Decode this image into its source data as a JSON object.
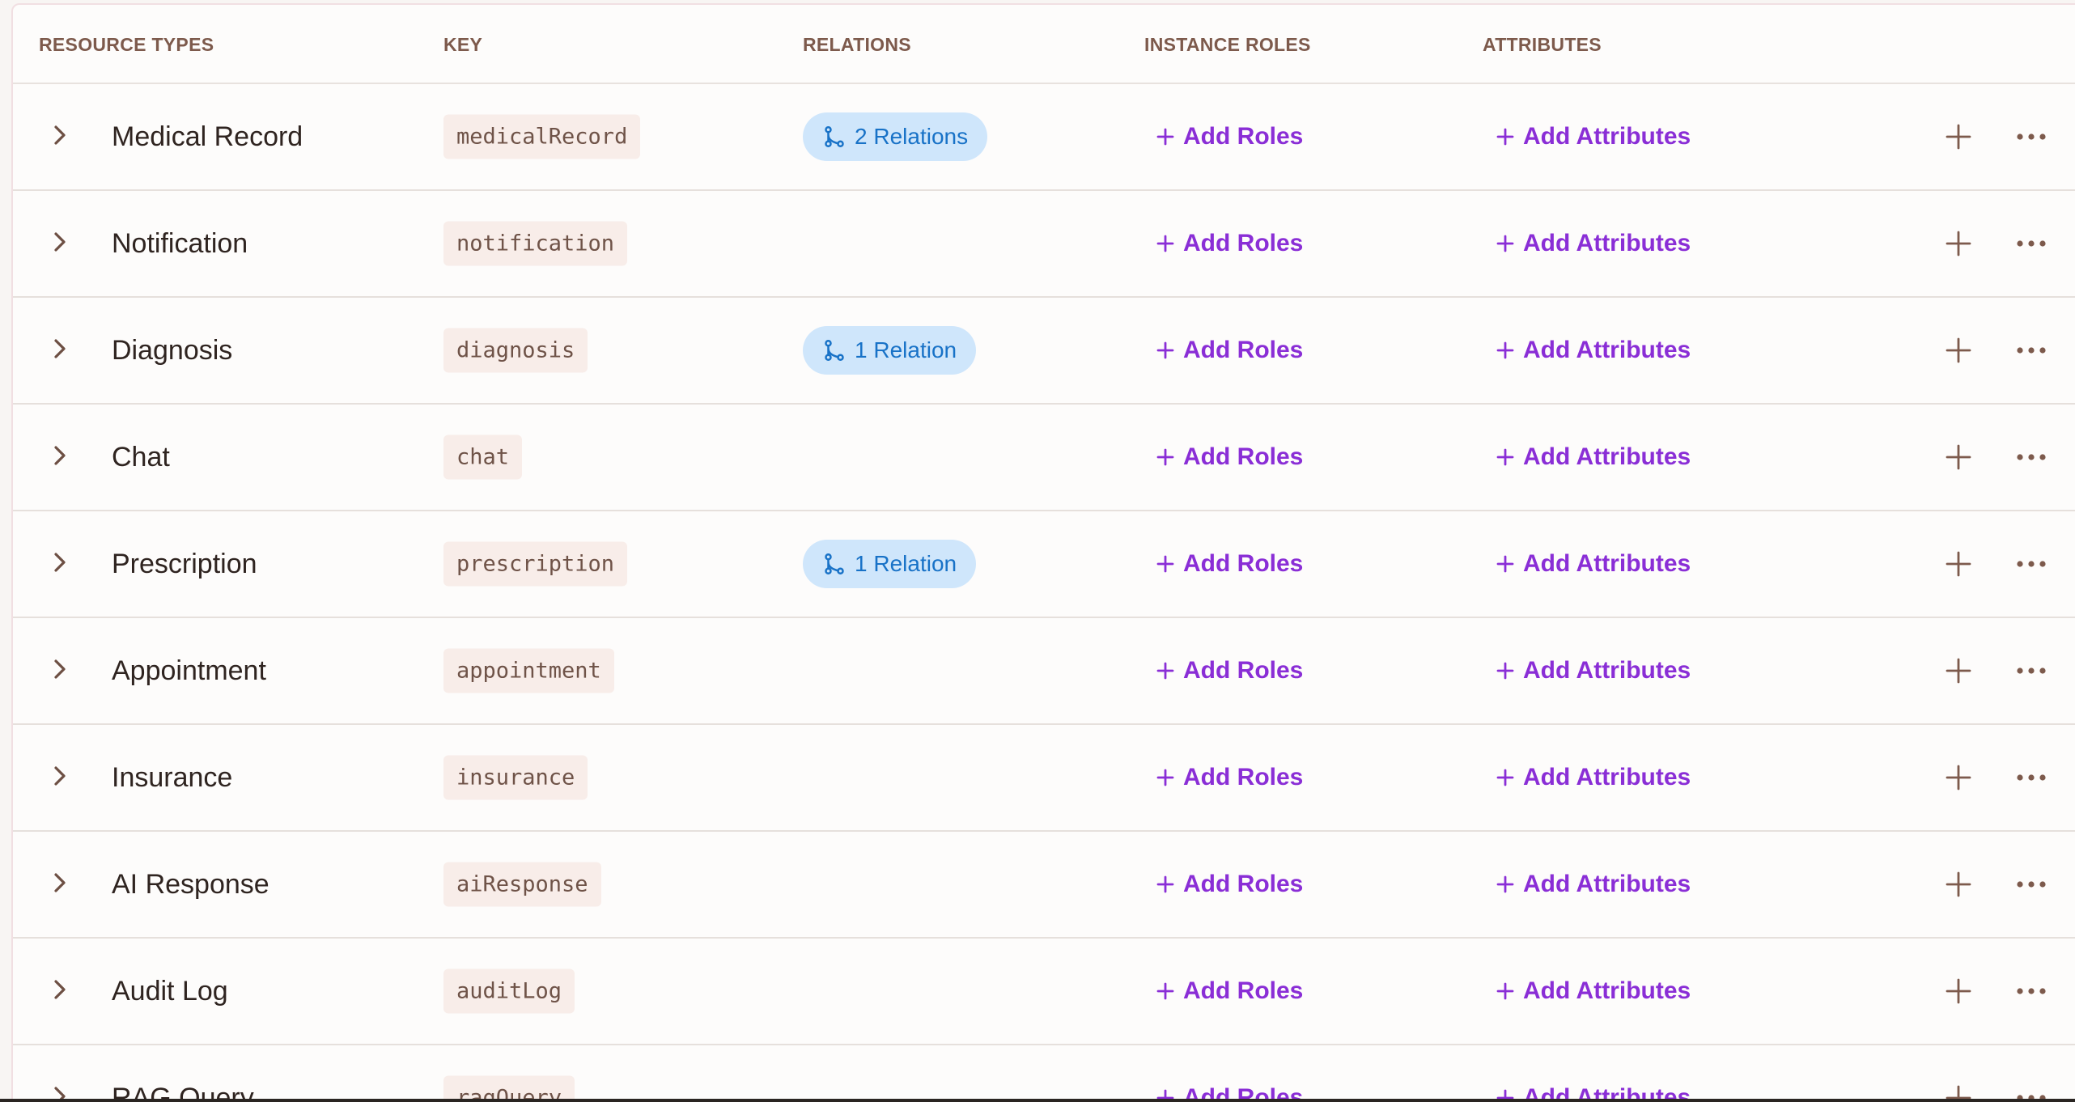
{
  "columns": {
    "resource_types": "RESOURCE TYPES",
    "key": "KEY",
    "relations": "RELATIONS",
    "instance_roles": "INSTANCE ROLES",
    "attributes": "ATTRIBUTES"
  },
  "actions": {
    "add_roles": "Add Roles",
    "add_attributes": "Add Attributes"
  },
  "colors": {
    "accent_purple": "#8a2ed6",
    "relation_blue": "#1872c7",
    "relation_bg": "#cfe6fb",
    "key_bg": "#f8ede9"
  },
  "icons": {
    "expand": "chevron-right-icon",
    "relation": "git-branch-icon",
    "add": "plus-icon",
    "more": "more-horizontal-icon"
  },
  "rows": [
    {
      "name": "Medical Record",
      "key": "medicalRecord",
      "relations": "2 Relations"
    },
    {
      "name": "Notification",
      "key": "notification",
      "relations": ""
    },
    {
      "name": "Diagnosis",
      "key": "diagnosis",
      "relations": "1 Relation"
    },
    {
      "name": "Chat",
      "key": "chat",
      "relations": ""
    },
    {
      "name": "Prescription",
      "key": "prescription",
      "relations": "1 Relation"
    },
    {
      "name": "Appointment",
      "key": "appointment",
      "relations": ""
    },
    {
      "name": "Insurance",
      "key": "insurance",
      "relations": ""
    },
    {
      "name": "AI Response",
      "key": "aiResponse",
      "relations": ""
    },
    {
      "name": "Audit Log",
      "key": "auditLog",
      "relations": ""
    },
    {
      "name": "RAG Query",
      "key": "ragQuery",
      "relations": ""
    }
  ]
}
